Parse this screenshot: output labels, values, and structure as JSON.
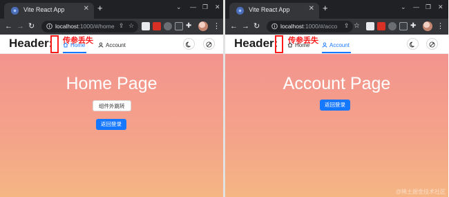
{
  "windows": [
    {
      "tab_title": "Vite React App",
      "url_host": "localhost",
      "url_rest": ":1000/#/home",
      "header_title": "Header:",
      "annotation": "传参丢失",
      "menu": [
        {
          "label": "Home",
          "icon": "home-icon",
          "active": true
        },
        {
          "label": "Account",
          "icon": "user-icon",
          "active": false
        }
      ],
      "page_title": "Home Page",
      "buttons": {
        "secondary": "组件外跳转",
        "primary": "返回登录"
      }
    },
    {
      "tab_title": "Vite React App",
      "url_host": "localhost",
      "url_rest": ":1000/#/acco",
      "header_title": "Header:",
      "annotation": "传参丢失",
      "menu": [
        {
          "label": "Home",
          "icon": "home-icon",
          "active": false
        },
        {
          "label": "Account",
          "icon": "user-icon",
          "active": true
        }
      ],
      "page_title": "Account Page",
      "buttons": {
        "primary": "返回登录"
      }
    }
  ],
  "watermark": "@稀土掘金技术社区",
  "colors": {
    "accent": "#1677ff",
    "annotation": "#ff1a1a",
    "gradient_top": "#f3948e",
    "gradient_bottom": "#f5b684",
    "chrome_dark": "#202124",
    "chrome_toolbar": "#35363a"
  },
  "icons": {
    "tab": "react-favicon",
    "nav": [
      "back-arrow-icon",
      "forward-arrow-icon",
      "reload-icon"
    ],
    "omnibox": [
      "info-icon",
      "share-icon",
      "star-icon"
    ],
    "toolbar": [
      "extension-icon",
      "puzzle-icon",
      "profile-avatar",
      "menu-dots-icon"
    ],
    "header_buttons": [
      "moon-icon",
      "palette-icon"
    ]
  }
}
